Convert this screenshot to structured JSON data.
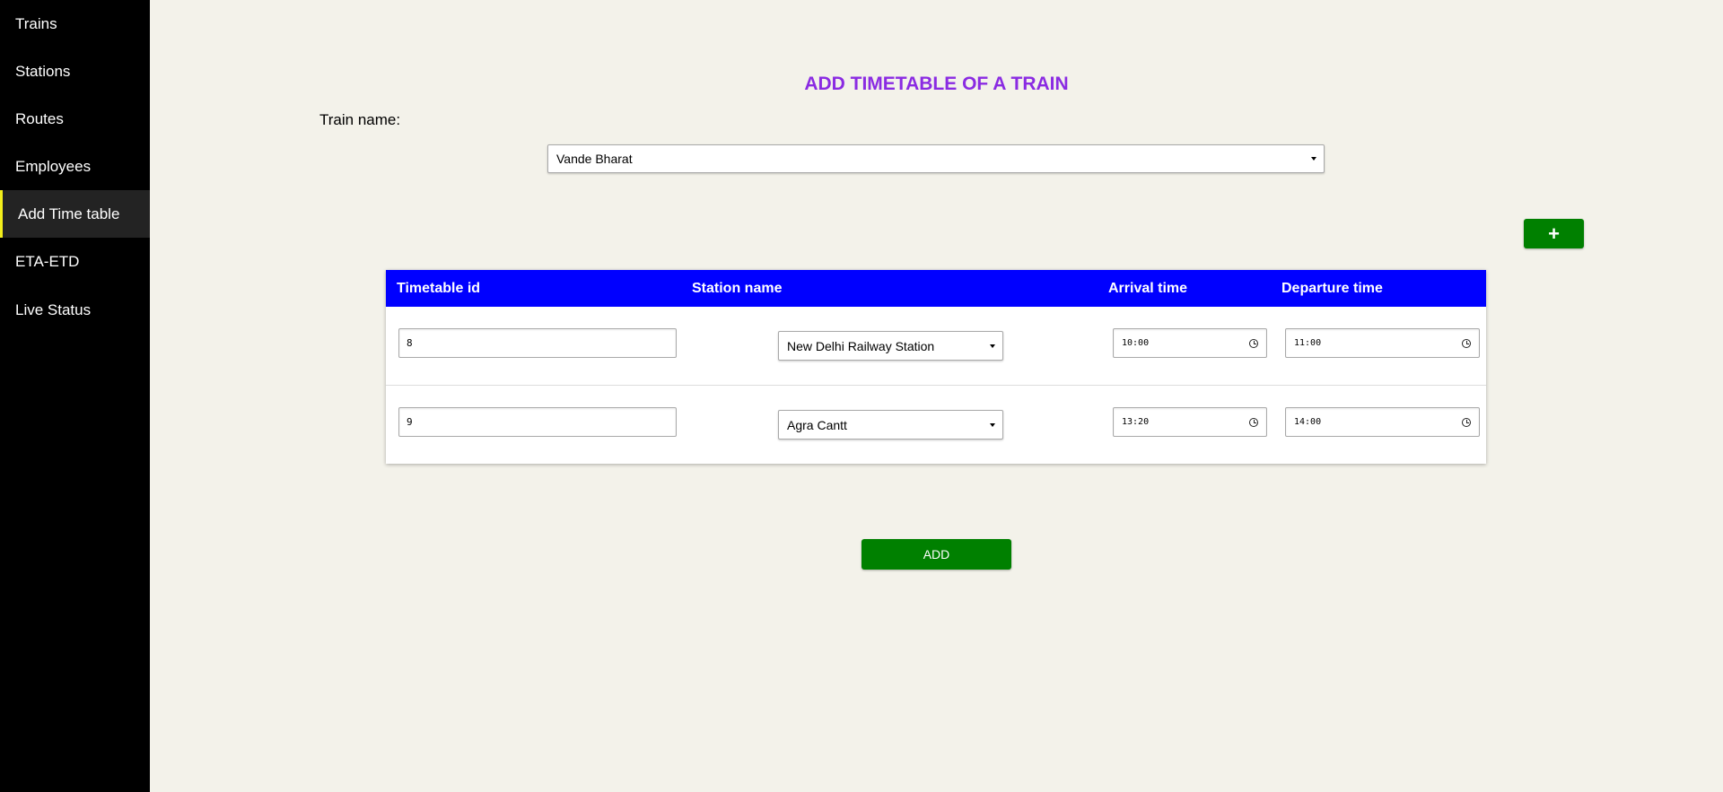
{
  "sidebar": {
    "items": [
      {
        "label": "Trains"
      },
      {
        "label": "Stations"
      },
      {
        "label": "Routes"
      },
      {
        "label": "Employees"
      },
      {
        "label": "Add Time table",
        "active": true
      },
      {
        "label": "ETA-ETD"
      },
      {
        "label": "Live Status"
      }
    ],
    "active_border_color": "#f2ee1b"
  },
  "page": {
    "title": "ADD TIMETABLE OF A TRAIN",
    "title_color": "#8a2be2",
    "train_label": "Train name:",
    "train_select_value": "Vande Bharat",
    "add_row_label": "+",
    "submit_label": "ADD",
    "button_color": "#008000"
  },
  "table": {
    "header_color": "#0000ff",
    "headers": [
      "Timetable id",
      "Station name",
      "Arrival time",
      "Departure time"
    ],
    "rows": [
      {
        "id": "8",
        "station": "New Delhi Railway Station",
        "arrival": "10:00",
        "departure": "11:00"
      },
      {
        "id": "9",
        "station": "Agra Cantt",
        "arrival": "13:20",
        "departure": "14:00"
      }
    ]
  }
}
